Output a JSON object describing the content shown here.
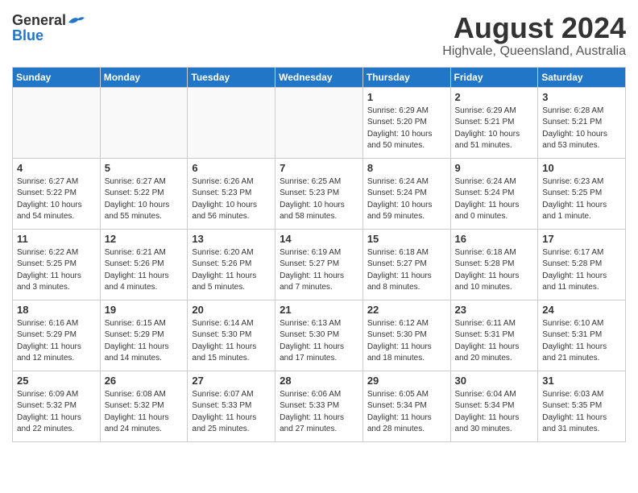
{
  "header": {
    "logo_general": "General",
    "logo_blue": "Blue",
    "month_title": "August 2024",
    "location": "Highvale, Queensland, Australia"
  },
  "days_of_week": [
    "Sunday",
    "Monday",
    "Tuesday",
    "Wednesday",
    "Thursday",
    "Friday",
    "Saturday"
  ],
  "weeks": [
    [
      {
        "day": "",
        "empty": true
      },
      {
        "day": "",
        "empty": true
      },
      {
        "day": "",
        "empty": true
      },
      {
        "day": "",
        "empty": true
      },
      {
        "day": "1",
        "sunrise": "Sunrise: 6:29 AM",
        "sunset": "Sunset: 5:20 PM",
        "daylight": "Daylight: 10 hours and 50 minutes."
      },
      {
        "day": "2",
        "sunrise": "Sunrise: 6:29 AM",
        "sunset": "Sunset: 5:21 PM",
        "daylight": "Daylight: 10 hours and 51 minutes."
      },
      {
        "day": "3",
        "sunrise": "Sunrise: 6:28 AM",
        "sunset": "Sunset: 5:21 PM",
        "daylight": "Daylight: 10 hours and 53 minutes."
      }
    ],
    [
      {
        "day": "4",
        "sunrise": "Sunrise: 6:27 AM",
        "sunset": "Sunset: 5:22 PM",
        "daylight": "Daylight: 10 hours and 54 minutes."
      },
      {
        "day": "5",
        "sunrise": "Sunrise: 6:27 AM",
        "sunset": "Sunset: 5:22 PM",
        "daylight": "Daylight: 10 hours and 55 minutes."
      },
      {
        "day": "6",
        "sunrise": "Sunrise: 6:26 AM",
        "sunset": "Sunset: 5:23 PM",
        "daylight": "Daylight: 10 hours and 56 minutes."
      },
      {
        "day": "7",
        "sunrise": "Sunrise: 6:25 AM",
        "sunset": "Sunset: 5:23 PM",
        "daylight": "Daylight: 10 hours and 58 minutes."
      },
      {
        "day": "8",
        "sunrise": "Sunrise: 6:24 AM",
        "sunset": "Sunset: 5:24 PM",
        "daylight": "Daylight: 10 hours and 59 minutes."
      },
      {
        "day": "9",
        "sunrise": "Sunrise: 6:24 AM",
        "sunset": "Sunset: 5:24 PM",
        "daylight": "Daylight: 11 hours and 0 minutes."
      },
      {
        "day": "10",
        "sunrise": "Sunrise: 6:23 AM",
        "sunset": "Sunset: 5:25 PM",
        "daylight": "Daylight: 11 hours and 1 minute."
      }
    ],
    [
      {
        "day": "11",
        "sunrise": "Sunrise: 6:22 AM",
        "sunset": "Sunset: 5:25 PM",
        "daylight": "Daylight: 11 hours and 3 minutes."
      },
      {
        "day": "12",
        "sunrise": "Sunrise: 6:21 AM",
        "sunset": "Sunset: 5:26 PM",
        "daylight": "Daylight: 11 hours and 4 minutes."
      },
      {
        "day": "13",
        "sunrise": "Sunrise: 6:20 AM",
        "sunset": "Sunset: 5:26 PM",
        "daylight": "Daylight: 11 hours and 5 minutes."
      },
      {
        "day": "14",
        "sunrise": "Sunrise: 6:19 AM",
        "sunset": "Sunset: 5:27 PM",
        "daylight": "Daylight: 11 hours and 7 minutes."
      },
      {
        "day": "15",
        "sunrise": "Sunrise: 6:18 AM",
        "sunset": "Sunset: 5:27 PM",
        "daylight": "Daylight: 11 hours and 8 minutes."
      },
      {
        "day": "16",
        "sunrise": "Sunrise: 6:18 AM",
        "sunset": "Sunset: 5:28 PM",
        "daylight": "Daylight: 11 hours and 10 minutes."
      },
      {
        "day": "17",
        "sunrise": "Sunrise: 6:17 AM",
        "sunset": "Sunset: 5:28 PM",
        "daylight": "Daylight: 11 hours and 11 minutes."
      }
    ],
    [
      {
        "day": "18",
        "sunrise": "Sunrise: 6:16 AM",
        "sunset": "Sunset: 5:29 PM",
        "daylight": "Daylight: 11 hours and 12 minutes."
      },
      {
        "day": "19",
        "sunrise": "Sunrise: 6:15 AM",
        "sunset": "Sunset: 5:29 PM",
        "daylight": "Daylight: 11 hours and 14 minutes."
      },
      {
        "day": "20",
        "sunrise": "Sunrise: 6:14 AM",
        "sunset": "Sunset: 5:30 PM",
        "daylight": "Daylight: 11 hours and 15 minutes."
      },
      {
        "day": "21",
        "sunrise": "Sunrise: 6:13 AM",
        "sunset": "Sunset: 5:30 PM",
        "daylight": "Daylight: 11 hours and 17 minutes."
      },
      {
        "day": "22",
        "sunrise": "Sunrise: 6:12 AM",
        "sunset": "Sunset: 5:30 PM",
        "daylight": "Daylight: 11 hours and 18 minutes."
      },
      {
        "day": "23",
        "sunrise": "Sunrise: 6:11 AM",
        "sunset": "Sunset: 5:31 PM",
        "daylight": "Daylight: 11 hours and 20 minutes."
      },
      {
        "day": "24",
        "sunrise": "Sunrise: 6:10 AM",
        "sunset": "Sunset: 5:31 PM",
        "daylight": "Daylight: 11 hours and 21 minutes."
      }
    ],
    [
      {
        "day": "25",
        "sunrise": "Sunrise: 6:09 AM",
        "sunset": "Sunset: 5:32 PM",
        "daylight": "Daylight: 11 hours and 22 minutes."
      },
      {
        "day": "26",
        "sunrise": "Sunrise: 6:08 AM",
        "sunset": "Sunset: 5:32 PM",
        "daylight": "Daylight: 11 hours and 24 minutes."
      },
      {
        "day": "27",
        "sunrise": "Sunrise: 6:07 AM",
        "sunset": "Sunset: 5:33 PM",
        "daylight": "Daylight: 11 hours and 25 minutes."
      },
      {
        "day": "28",
        "sunrise": "Sunrise: 6:06 AM",
        "sunset": "Sunset: 5:33 PM",
        "daylight": "Daylight: 11 hours and 27 minutes."
      },
      {
        "day": "29",
        "sunrise": "Sunrise: 6:05 AM",
        "sunset": "Sunset: 5:34 PM",
        "daylight": "Daylight: 11 hours and 28 minutes."
      },
      {
        "day": "30",
        "sunrise": "Sunrise: 6:04 AM",
        "sunset": "Sunset: 5:34 PM",
        "daylight": "Daylight: 11 hours and 30 minutes."
      },
      {
        "day": "31",
        "sunrise": "Sunrise: 6:03 AM",
        "sunset": "Sunset: 5:35 PM",
        "daylight": "Daylight: 11 hours and 31 minutes."
      }
    ]
  ]
}
